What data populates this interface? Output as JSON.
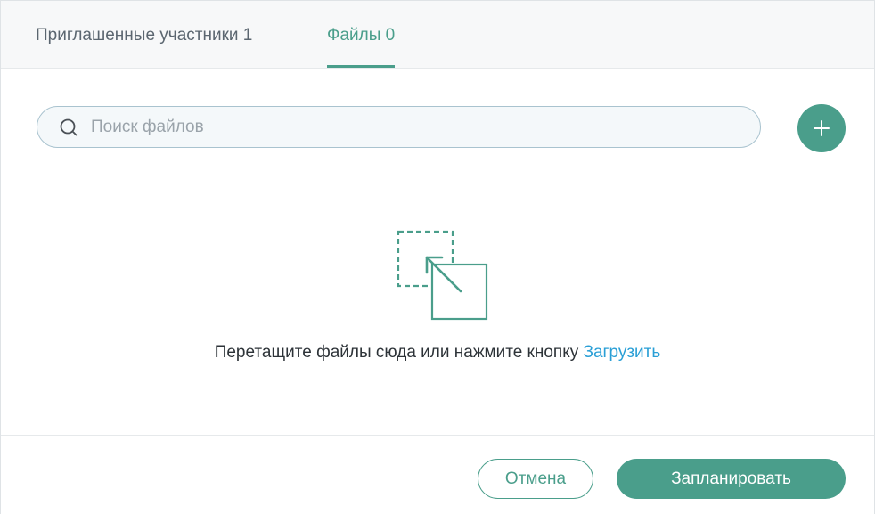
{
  "tabs": {
    "participants": "Приглашенные участники 1",
    "files": "Файлы 0",
    "active": "files"
  },
  "search": {
    "placeholder": "Поиск файлов",
    "value": "",
    "icon": "search-icon"
  },
  "add_button": {
    "icon": "plus-icon"
  },
  "dropzone": {
    "icon": "drag-drop-icon",
    "text": "Перетащите файлы сюда или нажмите кнопку",
    "link": "Загрузить"
  },
  "footer": {
    "cancel_label": "Отмена",
    "schedule_label": "Запланировать"
  },
  "colors": {
    "accent": "#4a9e8b",
    "link": "#2a9fd6",
    "tabbar_bg": "#f7f8f9"
  }
}
